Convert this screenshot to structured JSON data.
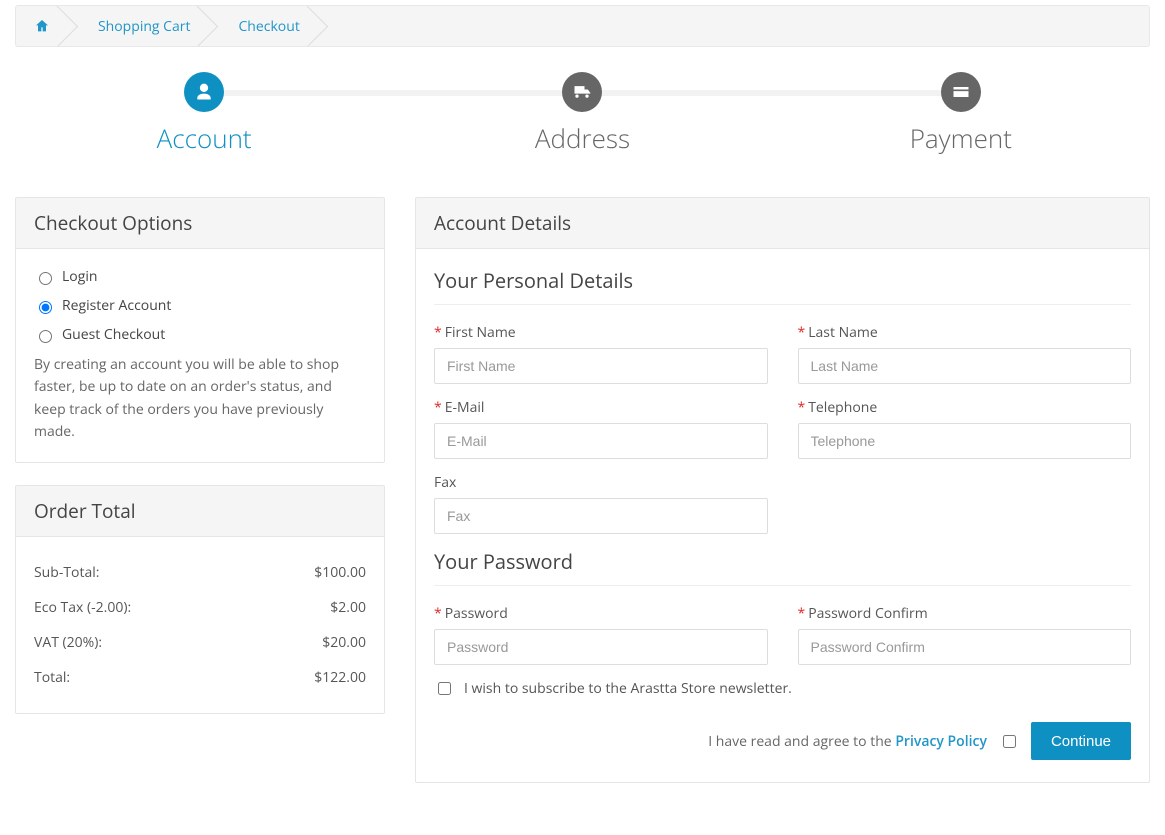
{
  "breadcrumb": {
    "home_label": "Home",
    "cart_label": "Shopping Cart",
    "checkout_label": "Checkout"
  },
  "steps": {
    "account": "Account",
    "address": "Address",
    "payment": "Payment"
  },
  "checkout_options": {
    "heading": "Checkout Options",
    "login_label": "Login",
    "register_label": "Register Account",
    "guest_label": "Guest Checkout",
    "help_text": "By creating an account you will be able to shop faster, be up to date on an order's status, and keep track of the orders you have previously made."
  },
  "order_total": {
    "heading": "Order Total",
    "rows": [
      {
        "label": "Sub-Total:",
        "value": "$100.00"
      },
      {
        "label": "Eco Tax (-2.00):",
        "value": "$2.00"
      },
      {
        "label": "VAT (20%):",
        "value": "$20.00"
      },
      {
        "label": "Total:",
        "value": "$122.00"
      }
    ]
  },
  "account_details": {
    "heading": "Account Details",
    "personal_title": "Your Personal Details",
    "password_title": "Your Password",
    "fields": {
      "first_name": {
        "label": "First Name",
        "placeholder": "First Name"
      },
      "last_name": {
        "label": "Last Name",
        "placeholder": "Last Name"
      },
      "email": {
        "label": "E-Mail",
        "placeholder": "E-Mail"
      },
      "telephone": {
        "label": "Telephone",
        "placeholder": "Telephone"
      },
      "fax": {
        "label": "Fax",
        "placeholder": "Fax"
      },
      "password": {
        "label": "Password",
        "placeholder": "Password"
      },
      "password_confirm": {
        "label": "Password Confirm",
        "placeholder": "Password Confirm"
      }
    },
    "newsletter_label": "I wish to subscribe to the Arastta Store newsletter.",
    "agree_prefix": "I have read and agree to the ",
    "agree_link": "Privacy Policy",
    "continue_label": "Continue"
  }
}
